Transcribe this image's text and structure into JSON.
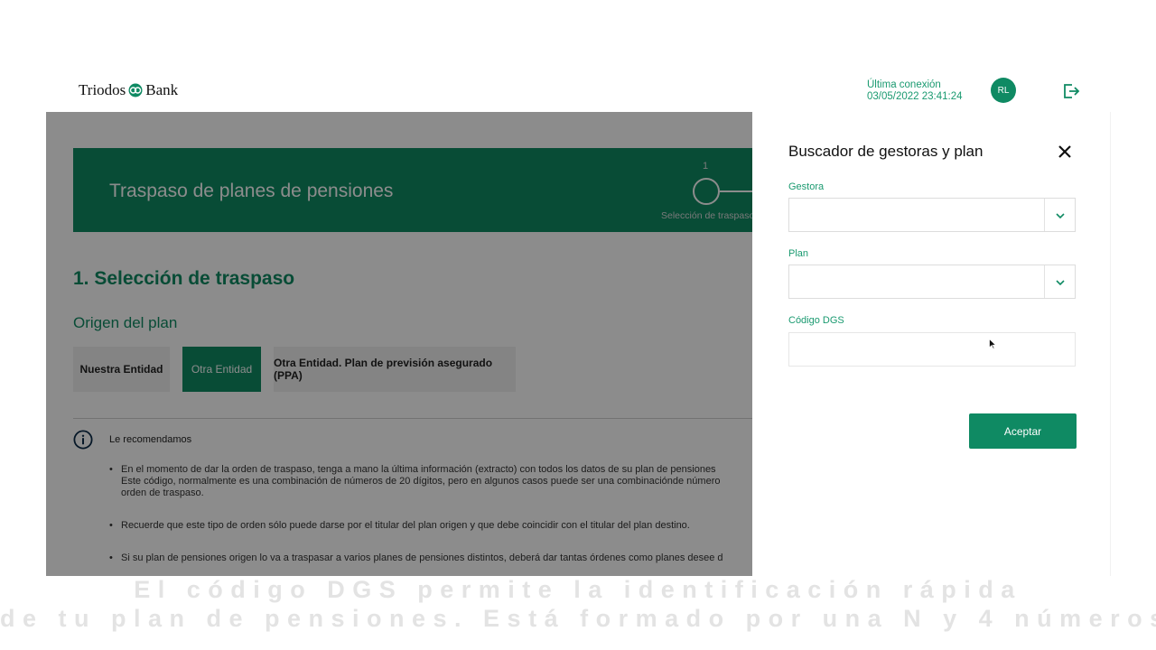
{
  "header": {
    "logo_left": "Triodos",
    "logo_right": "Bank",
    "last_connection_label": "Última conexión",
    "last_connection_value": "03/05/2022 23:41:24",
    "avatar_initials": "RL"
  },
  "main": {
    "banner_title": "Traspaso de planes de pensiones",
    "step_number": "1",
    "step_label": "Selección de traspaso",
    "section_title": "1. Selección de traspaso",
    "origin_title": "Origen del plan",
    "options": [
      "Nuestra Entidad",
      "Otra Entidad",
      "Otra Entidad. Plan de previsión asegurado (PPA)"
    ],
    "selected_option": "Otra Entidad",
    "recommend_label": "Le recomendamos",
    "bullets": [
      [
        "En el momento de dar la orden de traspaso, tenga a mano la última información (extracto) con todos los datos de su plan de pensiones",
        "Este código, normalmente es una combinación de números de 20 dígitos, pero en algunos casos puede ser una combinaciónde número",
        "orden de traspaso."
      ],
      [
        "Recuerde que este tipo de orden sólo puede darse por el titular del plan origen y que debe coincidir con el titular del plan destino."
      ],
      [
        "Si su plan de pensiones origen lo va a traspasar a varios planes de pensiones distintos, deberá dar tantas órdenes como planes desee d"
      ]
    ]
  },
  "panel": {
    "title": "Buscador de gestoras y plan",
    "gestora_label": "Gestora",
    "gestora_value": "",
    "plan_label": "Plan",
    "plan_value": "",
    "dgs_label": "Código DGS",
    "dgs_value": "",
    "accept_label": "Aceptar"
  },
  "caption": {
    "line1": "El código DGS permite la identificación rápida",
    "line2": "de tu plan de pensiones. Está formado por una N y 4 números"
  },
  "colors": {
    "brand_green": "#0f8a63",
    "label_green": "#1a9a70"
  }
}
